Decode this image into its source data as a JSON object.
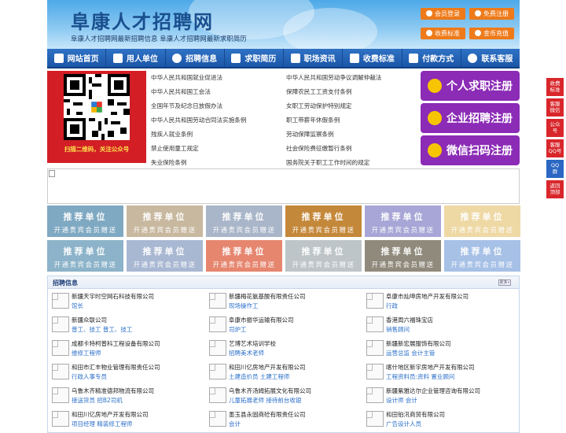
{
  "header": {
    "site_title": "阜康人才招聘网",
    "slogan": "阜康人才招聘网最新招聘信息   阜康人才招聘网最新求职简历",
    "buttons": [
      {
        "label": "会员登录",
        "icon": "user-icon"
      },
      {
        "label": "免费注册",
        "icon": "register-icon"
      },
      {
        "label": "收费标准",
        "icon": "money-icon"
      },
      {
        "label": "金币充值",
        "icon": "coin-icon"
      }
    ]
  },
  "nav": [
    {
      "label": "网站首页",
      "icon": "home-icon"
    },
    {
      "label": "用人单位",
      "icon": "building-icon"
    },
    {
      "label": "招聘信息",
      "icon": "megaphone-icon"
    },
    {
      "label": "求职简历",
      "icon": "resume-icon"
    },
    {
      "label": "职场资讯",
      "icon": "news-icon"
    },
    {
      "label": "收费标准",
      "icon": "price-icon"
    },
    {
      "label": "付款方式",
      "icon": "card-icon"
    },
    {
      "label": "联系客服",
      "icon": "phone-icon"
    }
  ],
  "qr": {
    "caption": "扫描二维码，关注公众号"
  },
  "laws": [
    [
      "中华人民共和国就业促进法",
      "中华人民共和国劳动争议调解仲裁法"
    ],
    [
      "中华人民共和国工会法",
      "保障农民工工资支付条例"
    ],
    [
      "全国年节及纪念日放假办法",
      "女职工劳动保护特别规定"
    ],
    [
      "中华人民共和国劳动合同法实施条例",
      "职工带薪年休假条例"
    ],
    [
      "残疾人就业条例",
      "劳动保障监察条例"
    ],
    [
      "禁止使用童工规定",
      "社会保险费征缴暂行条例"
    ],
    [
      "失业保险条例",
      "国务院关于职工工作时间的规定"
    ]
  ],
  "register_buttons": [
    {
      "label": "个人求职注册",
      "icon": "person-icon"
    },
    {
      "label": "企业招聘注册",
      "icon": "company-icon"
    },
    {
      "label": "微信扫码注册",
      "icon": "wechat-icon"
    }
  ],
  "ads": {
    "title": "推荐单位",
    "subtitle": "开通贵宾会员赠送",
    "colors": [
      "#7fa9c2",
      "#c7b89f",
      "#a9b5c8",
      "#c4883a",
      "#a7a6d6",
      "#eed8a4",
      "#8cb3c9",
      "#a9b8d2",
      "#e6866f",
      "#bdc5c8",
      "#8f8a7c",
      "#a6c0e6"
    ]
  },
  "jobs": {
    "title": "招聘信息",
    "more": "更多»",
    "items": [
      {
        "company": "新疆天宇时空网石科技有限公司",
        "positions": "馆长"
      },
      {
        "company": "新疆梅花氨基酸有限责任公司",
        "positions": "现场操作工"
      },
      {
        "company": "阜康市灿坤房地产开发有限公司",
        "positions": "行政"
      },
      {
        "company": "新疆众联公司",
        "positions": "普工、技工 普工、技工"
      },
      {
        "company": "阜康市振华运输有限公司",
        "positions": "司炉工"
      },
      {
        "company": "香港周六福珠宝店",
        "positions": "销售顾问"
      },
      {
        "company": "成都卡特柯普科工程设备有限公司",
        "positions": "维修工程师"
      },
      {
        "company": "艺博艺术培训学校",
        "positions": "招聘美术老师"
      },
      {
        "company": "新疆新宏展服饰有限公司",
        "positions": "运营总监 会计主管"
      },
      {
        "company": "和田市汇丰物业管理有限责任公司",
        "positions": "行政人事专员"
      },
      {
        "company": "和田川亿房地产开发有限公司",
        "positions": "土建造价员 土建工程师"
      },
      {
        "company": "喀什地区新宇房地产开发有限公司",
        "positions": "工程资料员:资料 置业顾问"
      },
      {
        "company": "乌鲁木齐精准德邦物流有限公司",
        "positions": "接送货员 招B2司机"
      },
      {
        "company": "乌鲁木齐汤姆拓展文化有限公司",
        "positions": "儿童拓展老师 接待前台收银"
      },
      {
        "company": "新疆紫雅达尔企业管理咨询有限公司",
        "positions": "设计师 会计"
      },
      {
        "company": "和田川亿房地产开发有限公司",
        "positions": "项目经理 精装修工程师"
      },
      {
        "company": "墨玉县永固商砼有限责任公司",
        "positions": "会计"
      },
      {
        "company": "和田铂汛商贸有限公司",
        "positions": "广告设计人员"
      }
    ]
  },
  "side": [
    {
      "label": "收费\n标准",
      "color": "#d9262b"
    },
    {
      "label": "客服\n微信",
      "color": "#d9262b"
    },
    {
      "label": "公众\n号",
      "color": "#d9262b"
    },
    {
      "label": "客服\nQQ号",
      "color": "#d9262b"
    },
    {
      "label": "QQ\n群",
      "color": "#2b67c3"
    },
    {
      "label": "返回\n顶部",
      "color": "#d9262b"
    }
  ]
}
